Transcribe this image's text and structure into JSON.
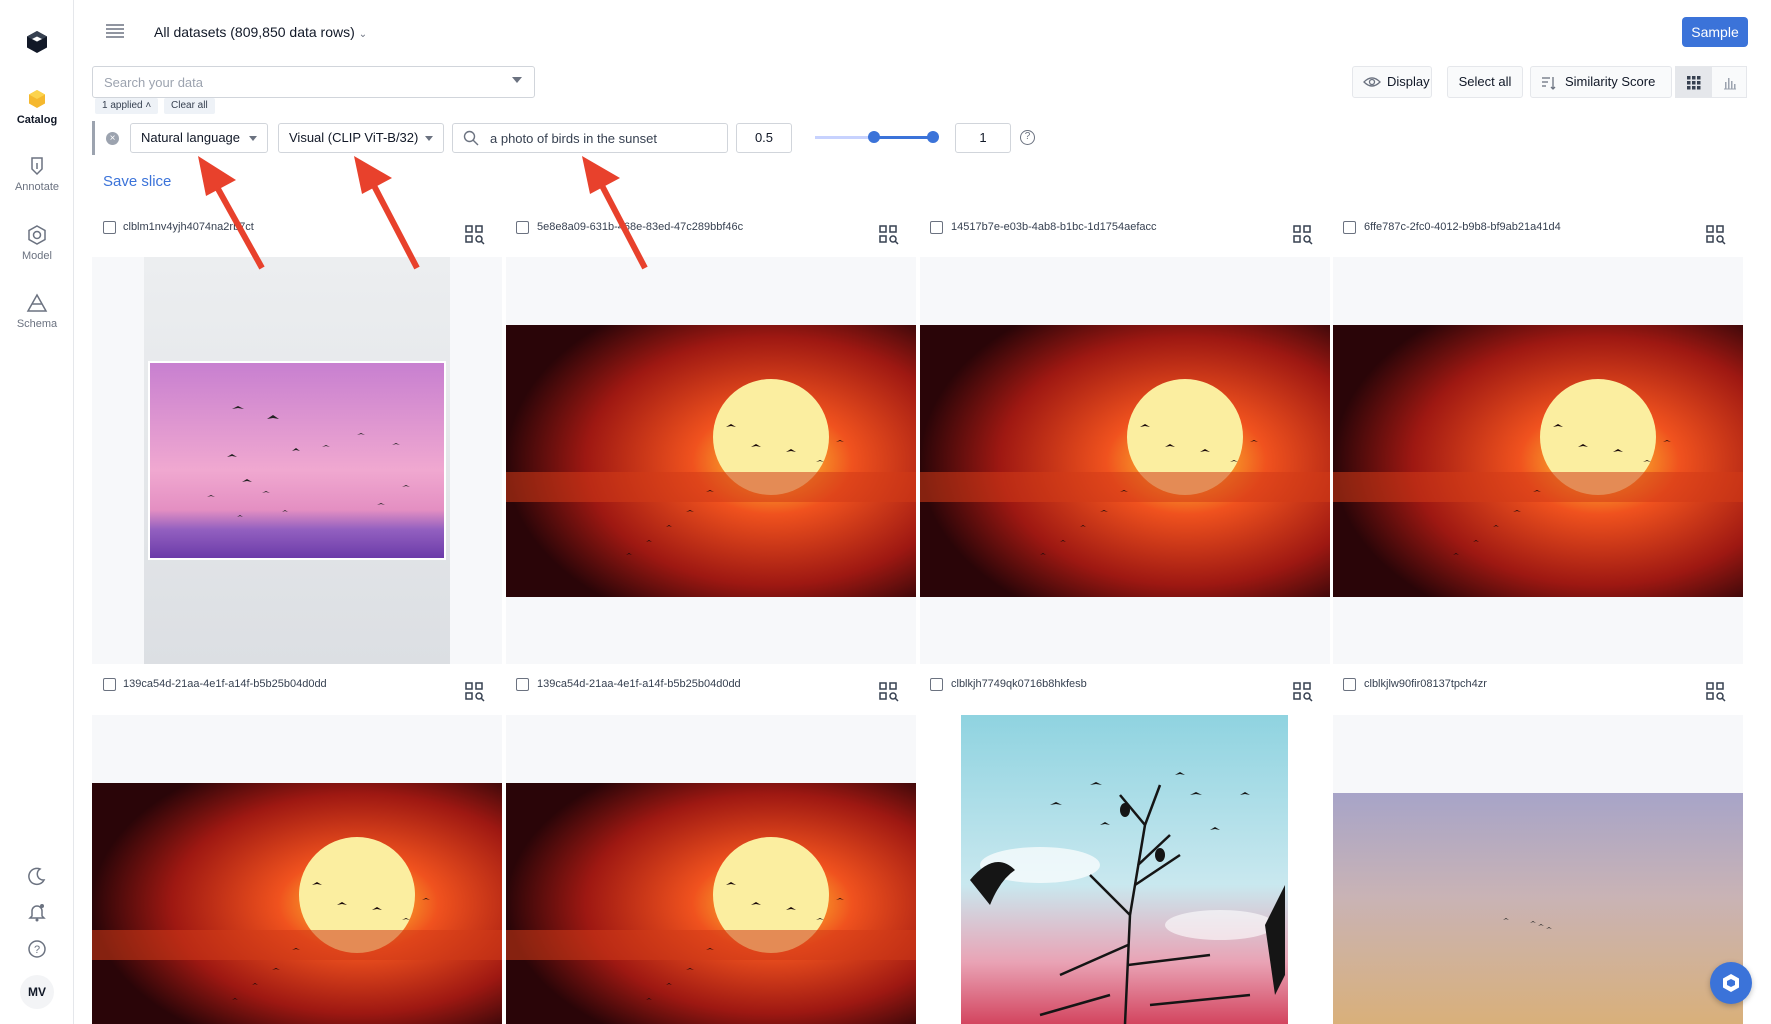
{
  "sidebar": {
    "items": [
      {
        "label": "Catalog",
        "icon": "catalog-icon",
        "active": true
      },
      {
        "label": "Annotate",
        "icon": "annotate-icon"
      },
      {
        "label": "Model",
        "icon": "model-icon"
      },
      {
        "label": "Schema",
        "icon": "schema-icon"
      }
    ],
    "bottom_icons": [
      "moon-icon",
      "bell-icon",
      "help-icon"
    ],
    "avatar_initials": "MV"
  },
  "header": {
    "dataset_title": "All datasets (809,850 data rows)",
    "sample_button": "Sample"
  },
  "search": {
    "placeholder": "Search your data",
    "applied_label": "1 applied",
    "clear_label": "Clear all"
  },
  "toolbar": {
    "display_label": "Display",
    "select_all_label": "Select all",
    "sort_label": "Similarity Score"
  },
  "filter": {
    "mode": "Natural language",
    "embedding": "Visual (CLIP ViT-B/32)",
    "query": "a photo of birds in the sunset",
    "min_value": "0.5",
    "max_value": "1",
    "slider_range": [
      0.5,
      1
    ]
  },
  "save_slice_label": "Save slice",
  "cards": [
    {
      "id": "clblm1nv4yjh4074na2rb7ct",
      "image": "pink-sky-birds"
    },
    {
      "id": "5e8e8a09-631b-468e-83ed-47c289bbf46c",
      "image": "sunset-birds"
    },
    {
      "id": "14517b7e-e03b-4ab8-b1bc-1d1754aefacc",
      "image": "sunset-birds"
    },
    {
      "id": "6ffe787c-2fc0-4012-b9b8-bf9ab21a41d4",
      "image": "sunset-birds"
    },
    {
      "id": "139ca54d-21aa-4e1f-a14f-b5b25b04d0dd",
      "image": "sunset-birds"
    },
    {
      "id": "139ca54d-21aa-4e1f-a14f-b5b25b04d0dd",
      "image": "sunset-birds"
    },
    {
      "id": "clblkjh7749qk0716b8hkfesb",
      "image": "tree-silhouette-birds"
    },
    {
      "id": "clblkjlw90fir08137tpch4zr",
      "image": "dusk-sky-birds"
    }
  ],
  "colors": {
    "accent": "#3b73d9",
    "annotation_arrow": "#e8412c"
  }
}
